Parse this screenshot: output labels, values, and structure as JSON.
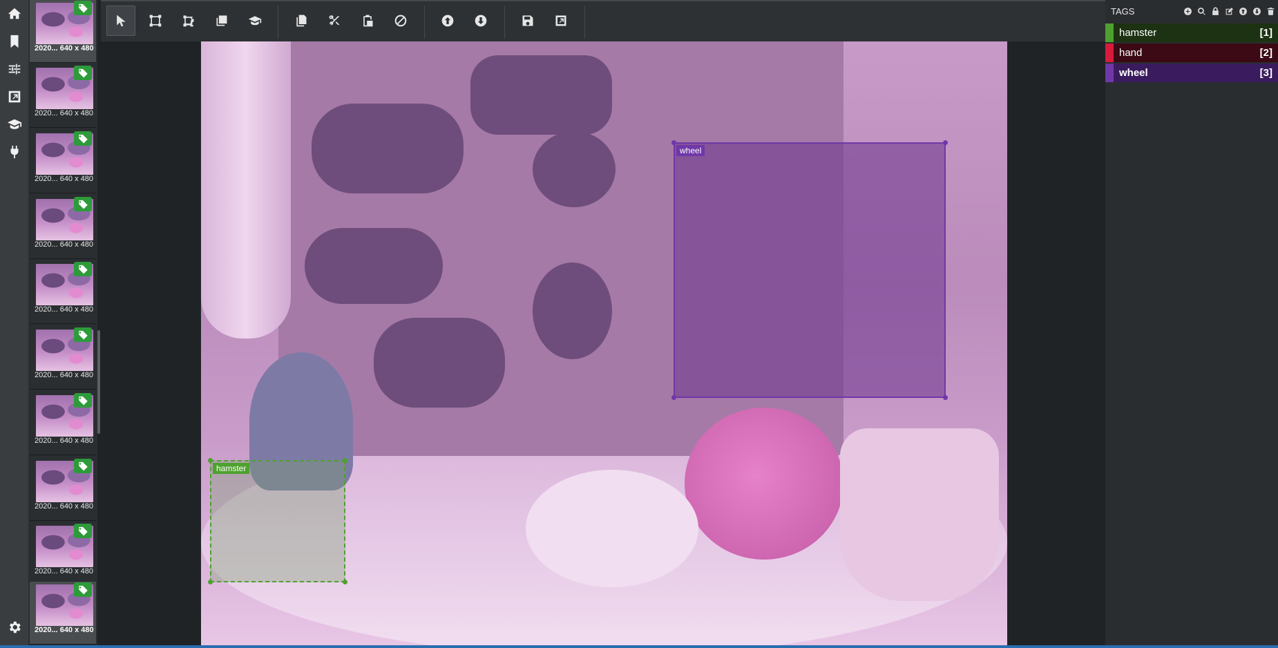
{
  "colors": {
    "hamster": "#4ea12e",
    "hand": "#d81b3c",
    "wheel": "#6f37a8",
    "accent": "#2a6db0"
  },
  "iconbar": {
    "items": [
      {
        "name": "home-icon"
      },
      {
        "name": "bookmark-icon"
      },
      {
        "name": "sliders-icon"
      },
      {
        "name": "export-icon"
      },
      {
        "name": "graduation-cap-icon"
      },
      {
        "name": "plug-icon"
      }
    ],
    "bottom": {
      "name": "gear-icon"
    }
  },
  "thumbnails": [
    {
      "caption": "2020... 640 x 480"
    },
    {
      "caption": "2020... 640 x 480"
    },
    {
      "caption": "2020... 640 x 480"
    },
    {
      "caption": "2020... 640 x 480"
    },
    {
      "caption": "2020... 640 x 480"
    },
    {
      "caption": "2020... 640 x 480"
    },
    {
      "caption": "2020... 640 x 480"
    },
    {
      "caption": "2020... 640 x 480"
    },
    {
      "caption": "2020... 640 x 480"
    },
    {
      "caption": "2020... 640 x 480"
    }
  ],
  "toolbar": {
    "tools": [
      {
        "name": "select-pointer-icon"
      },
      {
        "name": "draw-rectangle-icon"
      },
      {
        "name": "draw-polygon-icon"
      },
      {
        "name": "copy-rectangle-icon"
      },
      {
        "name": "active-learning-icon"
      },
      {
        "name": "copy-regions-icon"
      },
      {
        "name": "cut-regions-icon"
      },
      {
        "name": "paste-regions-icon"
      },
      {
        "name": "remove-all-regions-icon"
      },
      {
        "name": "previous-asset-icon"
      },
      {
        "name": "next-asset-icon"
      },
      {
        "name": "save-project-icon"
      },
      {
        "name": "export-project-icon"
      }
    ]
  },
  "regions": {
    "wheel": {
      "label": "wheel"
    },
    "hamster": {
      "label": "hamster"
    }
  },
  "tags_panel": {
    "title": "TAGS",
    "actions": [
      {
        "name": "add-tag-icon"
      },
      {
        "name": "search-tags-icon"
      },
      {
        "name": "lock-tag-icon"
      },
      {
        "name": "edit-tag-icon"
      },
      {
        "name": "move-tag-up-icon"
      },
      {
        "name": "move-tag-down-icon"
      },
      {
        "name": "delete-tag-icon"
      }
    ],
    "tags": [
      {
        "name": "hamster",
        "hotkey": "[1]",
        "color": "#4ea12e",
        "bg": "#1c3212"
      },
      {
        "name": "hand",
        "hotkey": "[2]",
        "color": "#d81b3c",
        "bg": "#3b0a14"
      },
      {
        "name": "wheel",
        "hotkey": "[3]",
        "color": "#6f37a8",
        "bg": "#3a1c5e"
      }
    ]
  }
}
